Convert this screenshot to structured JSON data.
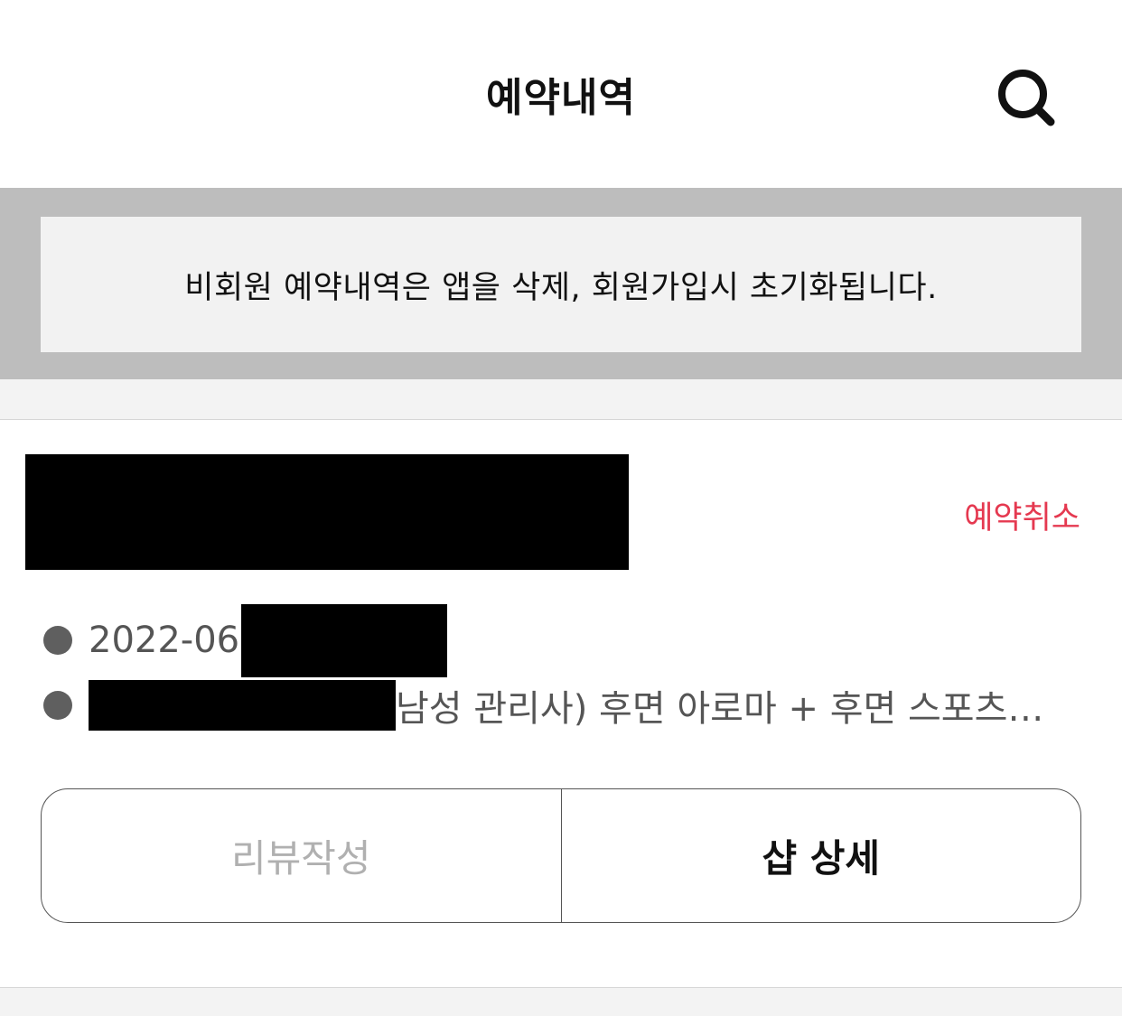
{
  "header": {
    "title": "예약내역",
    "search_icon": "search-icon"
  },
  "notice": {
    "text": "비회원 예약내역은 앱을 삭제, 회원가입시 초기화됩니다."
  },
  "reservation": {
    "cancel_label": "예약취소",
    "date_visible": "2022-06",
    "service_visible": "남성 관리사) 후면 아로마 + 후면 스포츠…",
    "review_button": "리뷰작성",
    "shop_detail_button": "샵 상세"
  },
  "colors": {
    "accent_red": "#e53950",
    "notice_band": "#bdbdbd",
    "notice_box": "#f2f2f2",
    "disabled_text": "#b0b0b0"
  }
}
